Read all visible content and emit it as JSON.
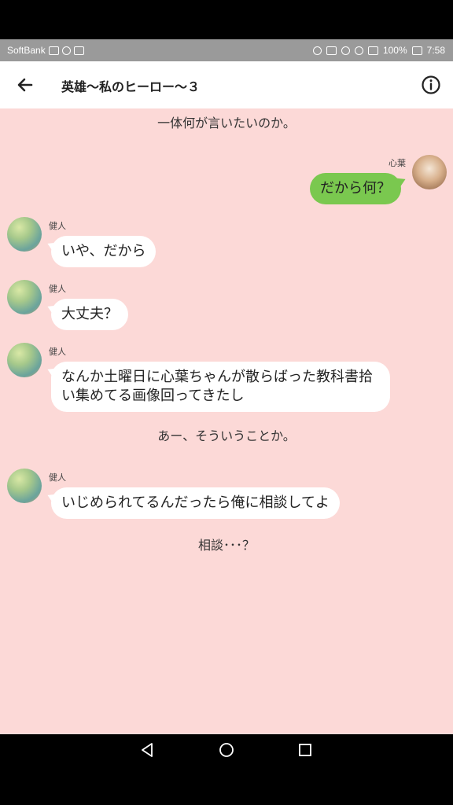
{
  "status_bar": {
    "carrier": "SoftBank",
    "battery": "100%",
    "time": "7:58"
  },
  "header": {
    "title": "英雄〜私のヒーロー〜３",
    "back_icon": "arrow-left-icon",
    "info_icon": "info-icon"
  },
  "messages": [
    {
      "type": "narration",
      "text": "一体何が言いたいのか。"
    },
    {
      "type": "right",
      "name": "心葉",
      "text": "だから何？"
    },
    {
      "type": "left",
      "name": "健人",
      "text": "いや、だから"
    },
    {
      "type": "left",
      "name": "健人",
      "text": "大丈夫？"
    },
    {
      "type": "left",
      "name": "健人",
      "text": "なんか土曜日に心葉ちゃんが散らばった教科書拾い集めてる画像回ってきたし"
    },
    {
      "type": "narration",
      "text": "あー、そういうことか。"
    },
    {
      "type": "left",
      "name": "健人",
      "text": "いじめられてるんだったら俺に相談してよ"
    },
    {
      "type": "narration",
      "text": "相談･･･？"
    }
  ],
  "colors": {
    "chat_background": "#fcd9d7",
    "right_bubble": "#7ac84f",
    "left_bubble": "#ffffff",
    "status_bar": "#9a9a9a"
  },
  "nav_bar": {
    "back_icon": "triangle-back-icon",
    "home_icon": "circle-home-icon",
    "recents_icon": "square-recents-icon"
  }
}
